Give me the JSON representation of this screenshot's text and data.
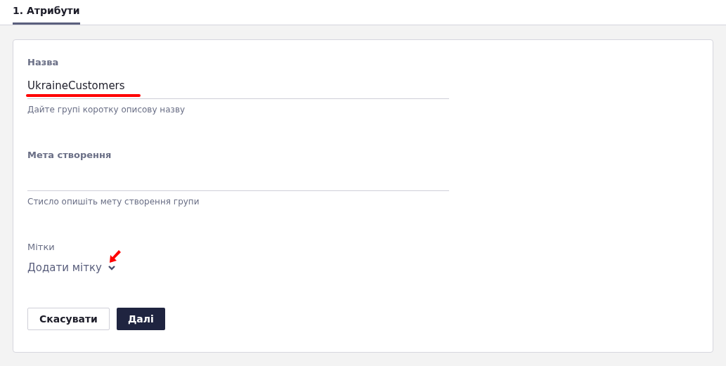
{
  "tabs": [
    {
      "label": "1. Атрибути",
      "selected": true
    }
  ],
  "form": {
    "fields": [
      {
        "label": "Назва",
        "value": "UkraineCustomers",
        "hint": "Дайте групі коротку описову назву",
        "highlighted": true
      },
      {
        "label": "Мета створення",
        "hint": "Стисло опишіть мету створення групи",
        "highlighted": false
      }
    ],
    "tags": {
      "label": "Мітки",
      "action": "Додати мітку",
      "pointed": true
    },
    "buttons": [
      {
        "label": "Скасувати",
        "kind": "secondary"
      },
      {
        "label": "Далі",
        "kind": "primary"
      }
    ]
  }
}
